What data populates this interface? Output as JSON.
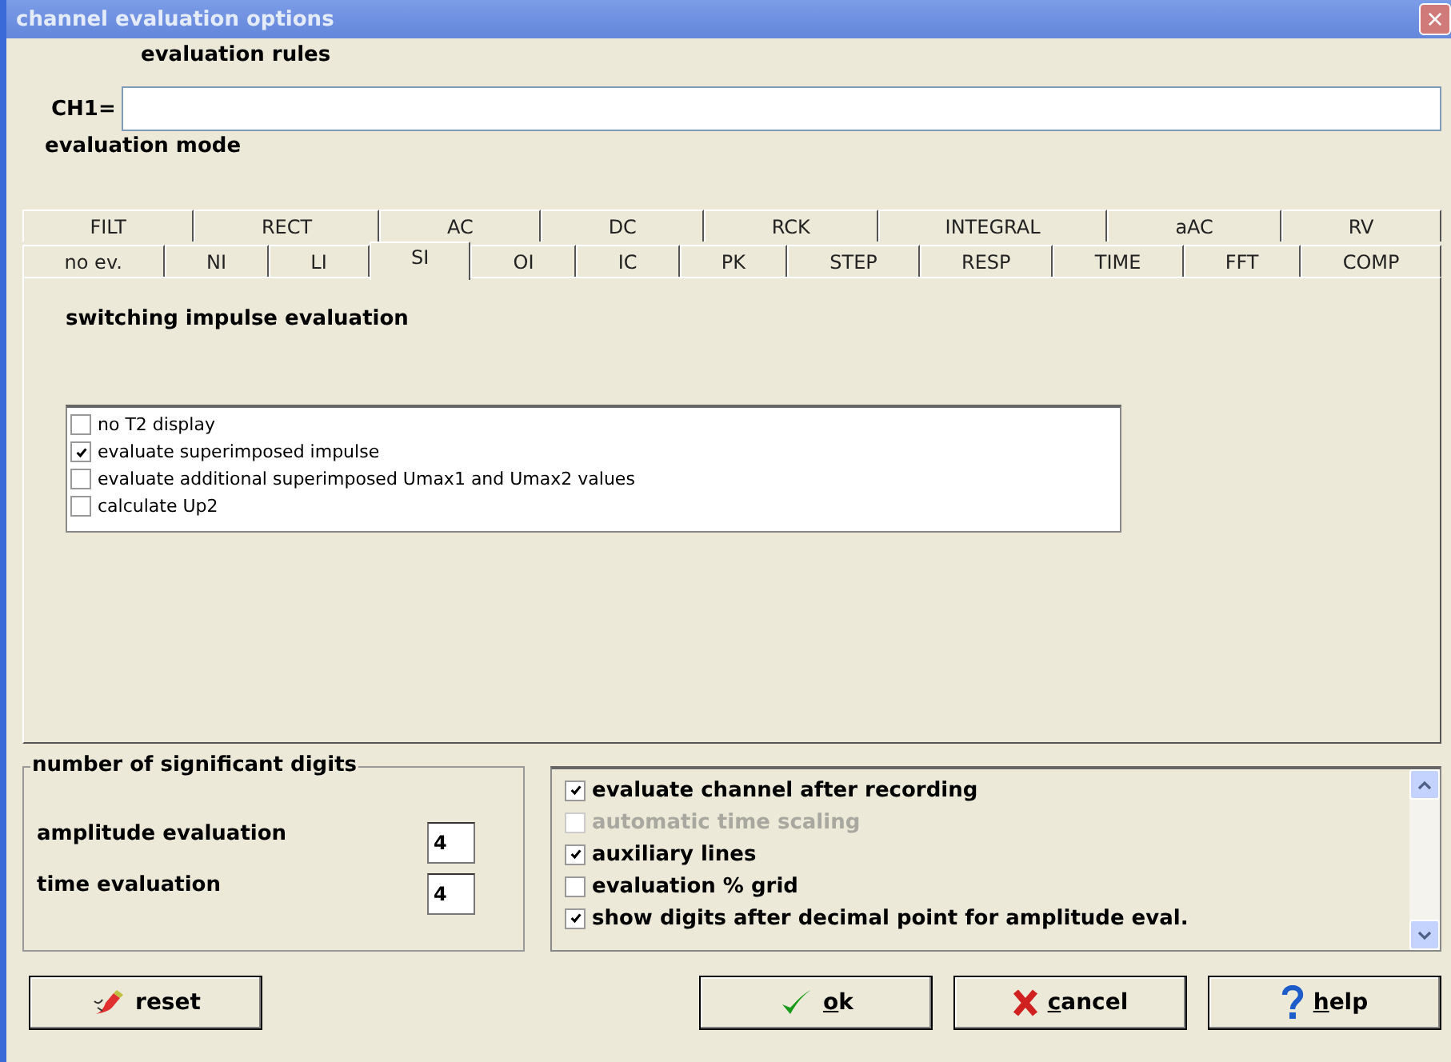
{
  "window": {
    "title": "channel evaluation options",
    "close": "×"
  },
  "rules": {
    "heading": "evaluation rules",
    "label": "CH1="
  },
  "mode": {
    "heading": "evaluation mode"
  },
  "tab_rows": [
    [
      {
        "label": "FILT",
        "selected": false
      },
      {
        "label": "RECT",
        "selected": false
      },
      {
        "label": "AC",
        "selected": false
      },
      {
        "label": "DC",
        "selected": false
      },
      {
        "label": "RCK",
        "selected": false
      },
      {
        "label": "INTEGRAL",
        "selected": false
      },
      {
        "label": "aAC",
        "selected": false
      },
      {
        "label": "RV",
        "selected": false
      }
    ],
    [
      {
        "label": "no ev.",
        "selected": false
      },
      {
        "label": "NI",
        "selected": false
      },
      {
        "label": "LI",
        "selected": false
      },
      {
        "label": "SI",
        "selected": true
      },
      {
        "label": "OI",
        "selected": false
      },
      {
        "label": "IC",
        "selected": false
      },
      {
        "label": "PK",
        "selected": false
      },
      {
        "label": "STEP",
        "selected": false
      },
      {
        "label": "RESP",
        "selected": false
      },
      {
        "label": "TIME",
        "selected": false
      },
      {
        "label": "FFT",
        "selected": false
      },
      {
        "label": "COMP",
        "selected": false
      }
    ]
  ],
  "panel": {
    "title": "switching impulse evaluation",
    "options": [
      {
        "label": "no T2 display",
        "checked": false
      },
      {
        "label": "evaluate superimposed impulse",
        "checked": true
      },
      {
        "label": "evaluate additional superimposed Umax1 and Umax2 values",
        "checked": false
      },
      {
        "label": "calculate Up2",
        "checked": false
      }
    ]
  },
  "digits": {
    "title": "number of significant digits",
    "fields": [
      {
        "label": "amplitude evaluation",
        "value": "4"
      },
      {
        "label": "time evaluation",
        "value": "4"
      }
    ]
  },
  "options": [
    {
      "label": "evaluate channel after recording",
      "checked": true,
      "disabled": false
    },
    {
      "label": "automatic time scaling",
      "checked": false,
      "disabled": true
    },
    {
      "label": "auxiliary lines",
      "checked": true,
      "disabled": false
    },
    {
      "label": "evaluation % grid",
      "checked": false,
      "disabled": false
    },
    {
      "label": "show digits after decimal point for amplitude eval.",
      "checked": true,
      "disabled": false
    }
  ],
  "buttons": [
    {
      "kind": "reset",
      "label": "reset"
    },
    {
      "kind": "ok",
      "label": "ok"
    },
    {
      "kind": "cancel",
      "label": "cancel"
    },
    {
      "kind": "help",
      "label": "help"
    }
  ]
}
